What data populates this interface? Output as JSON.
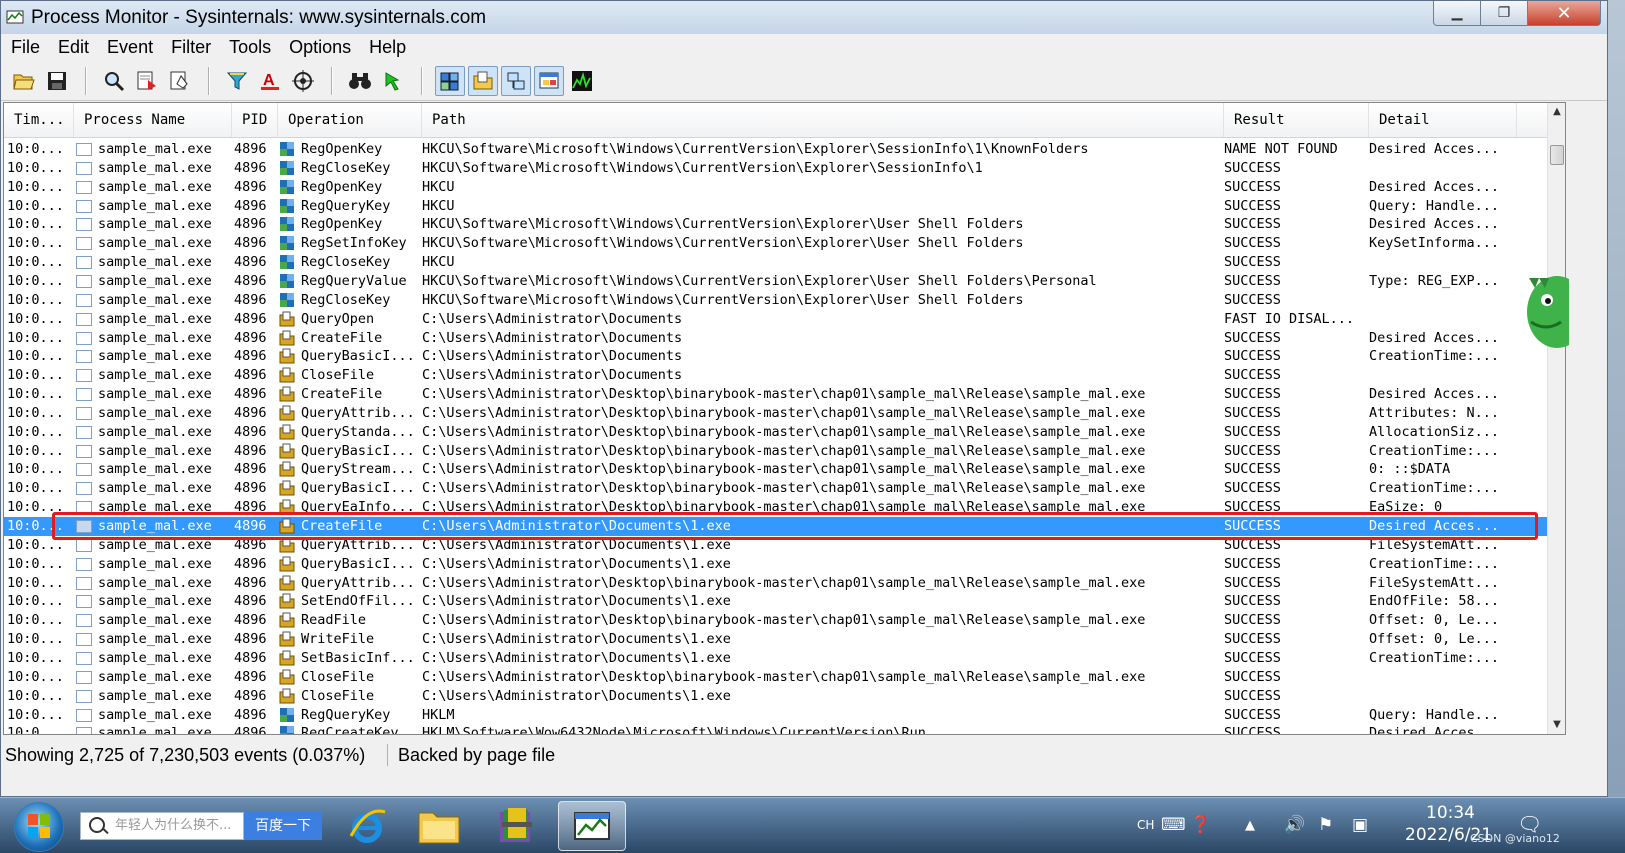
{
  "window": {
    "title": "Process Monitor - Sysinternals: www.sysinternals.com",
    "minimize": "▁",
    "maximize": "❐",
    "close": "✕"
  },
  "menu": [
    "File",
    "Edit",
    "Event",
    "Filter",
    "Tools",
    "Options",
    "Help"
  ],
  "toolbar": {
    "open": "📂",
    "save": "💾",
    "find": "🔍",
    "jump": "⇗",
    "bookmark": "✎",
    "filter": "⏷",
    "highlight": "A",
    "target": "⊕",
    "binoculars": "👓",
    "jump_to": "➜",
    "show_registry": "▦",
    "show_file": "▤",
    "show_network": "⧉",
    "show_process": "▣",
    "show_profiling": "▲"
  },
  "columns": [
    "Tim...",
    "Process Name",
    "PID",
    "Operation",
    "Path",
    "Result",
    "Detail"
  ],
  "rows": [
    {
      "time": "10:0...",
      "pname": "sample_mal.exe",
      "pid": "4896",
      "op": "RegOpenKey",
      "path": "HKCU\\Software\\Microsoft\\Windows\\CurrentVersion\\Explorer\\SessionInfo\\1\\KnownFolders",
      "result": "NAME NOT FOUND",
      "detail": "Desired Acces...",
      "kind": "reg"
    },
    {
      "time": "10:0...",
      "pname": "sample_mal.exe",
      "pid": "4896",
      "op": "RegCloseKey",
      "path": "HKCU\\Software\\Microsoft\\Windows\\CurrentVersion\\Explorer\\SessionInfo\\1",
      "result": "SUCCESS",
      "detail": "",
      "kind": "reg"
    },
    {
      "time": "10:0...",
      "pname": "sample_mal.exe",
      "pid": "4896",
      "op": "RegOpenKey",
      "path": "HKCU",
      "result": "SUCCESS",
      "detail": "Desired Acces...",
      "kind": "reg"
    },
    {
      "time": "10:0...",
      "pname": "sample_mal.exe",
      "pid": "4896",
      "op": "RegQueryKey",
      "path": "HKCU",
      "result": "SUCCESS",
      "detail": "Query: Handle...",
      "kind": "reg"
    },
    {
      "time": "10:0...",
      "pname": "sample_mal.exe",
      "pid": "4896",
      "op": "RegOpenKey",
      "path": "HKCU\\Software\\Microsoft\\Windows\\CurrentVersion\\Explorer\\User Shell Folders",
      "result": "SUCCESS",
      "detail": "Desired Acces...",
      "kind": "reg"
    },
    {
      "time": "10:0...",
      "pname": "sample_mal.exe",
      "pid": "4896",
      "op": "RegSetInfoKey",
      "path": "HKCU\\Software\\Microsoft\\Windows\\CurrentVersion\\Explorer\\User Shell Folders",
      "result": "SUCCESS",
      "detail": "KeySetInforma...",
      "kind": "reg"
    },
    {
      "time": "10:0...",
      "pname": "sample_mal.exe",
      "pid": "4896",
      "op": "RegCloseKey",
      "path": "HKCU",
      "result": "SUCCESS",
      "detail": "",
      "kind": "reg"
    },
    {
      "time": "10:0...",
      "pname": "sample_mal.exe",
      "pid": "4896",
      "op": "RegQueryValue",
      "path": "HKCU\\Software\\Microsoft\\Windows\\CurrentVersion\\Explorer\\User Shell Folders\\Personal",
      "result": "SUCCESS",
      "detail": "Type: REG_EXP...",
      "kind": "reg"
    },
    {
      "time": "10:0...",
      "pname": "sample_mal.exe",
      "pid": "4896",
      "op": "RegCloseKey",
      "path": "HKCU\\Software\\Microsoft\\Windows\\CurrentVersion\\Explorer\\User Shell Folders",
      "result": "SUCCESS",
      "detail": "",
      "kind": "reg"
    },
    {
      "time": "10:0...",
      "pname": "sample_mal.exe",
      "pid": "4896",
      "op": "QueryOpen",
      "path": "C:\\Users\\Administrator\\Documents",
      "result": "FAST IO DISAL...",
      "detail": "",
      "kind": "file"
    },
    {
      "time": "10:0...",
      "pname": "sample_mal.exe",
      "pid": "4896",
      "op": "CreateFile",
      "path": "C:\\Users\\Administrator\\Documents",
      "result": "SUCCESS",
      "detail": "Desired Acces...",
      "kind": "file"
    },
    {
      "time": "10:0...",
      "pname": "sample_mal.exe",
      "pid": "4896",
      "op": "QueryBasicI...",
      "path": "C:\\Users\\Administrator\\Documents",
      "result": "SUCCESS",
      "detail": "CreationTime:...",
      "kind": "file"
    },
    {
      "time": "10:0...",
      "pname": "sample_mal.exe",
      "pid": "4896",
      "op": "CloseFile",
      "path": "C:\\Users\\Administrator\\Documents",
      "result": "SUCCESS",
      "detail": "",
      "kind": "file"
    },
    {
      "time": "10:0...",
      "pname": "sample_mal.exe",
      "pid": "4896",
      "op": "CreateFile",
      "path": "C:\\Users\\Administrator\\Desktop\\binarybook-master\\chap01\\sample_mal\\Release\\sample_mal.exe",
      "result": "SUCCESS",
      "detail": "Desired Acces...",
      "kind": "file"
    },
    {
      "time": "10:0...",
      "pname": "sample_mal.exe",
      "pid": "4896",
      "op": "QueryAttrib...",
      "path": "C:\\Users\\Administrator\\Desktop\\binarybook-master\\chap01\\sample_mal\\Release\\sample_mal.exe",
      "result": "SUCCESS",
      "detail": "Attributes: N...",
      "kind": "file"
    },
    {
      "time": "10:0...",
      "pname": "sample_mal.exe",
      "pid": "4896",
      "op": "QueryStanda...",
      "path": "C:\\Users\\Administrator\\Desktop\\binarybook-master\\chap01\\sample_mal\\Release\\sample_mal.exe",
      "result": "SUCCESS",
      "detail": "AllocationSiz...",
      "kind": "file"
    },
    {
      "time": "10:0...",
      "pname": "sample_mal.exe",
      "pid": "4896",
      "op": "QueryBasicI...",
      "path": "C:\\Users\\Administrator\\Desktop\\binarybook-master\\chap01\\sample_mal\\Release\\sample_mal.exe",
      "result": "SUCCESS",
      "detail": "CreationTime:...",
      "kind": "file"
    },
    {
      "time": "10:0...",
      "pname": "sample_mal.exe",
      "pid": "4896",
      "op": "QueryStream...",
      "path": "C:\\Users\\Administrator\\Desktop\\binarybook-master\\chap01\\sample_mal\\Release\\sample_mal.exe",
      "result": "SUCCESS",
      "detail": "0: ::$DATA",
      "kind": "file"
    },
    {
      "time": "10:0...",
      "pname": "sample_mal.exe",
      "pid": "4896",
      "op": "QueryBasicI...",
      "path": "C:\\Users\\Administrator\\Desktop\\binarybook-master\\chap01\\sample_mal\\Release\\sample_mal.exe",
      "result": "SUCCESS",
      "detail": "CreationTime:...",
      "kind": "file"
    },
    {
      "time": "10:0...",
      "pname": "sample_mal.exe",
      "pid": "4896",
      "op": "QueryEaInfo...",
      "path": "C:\\Users\\Administrator\\Desktop\\binarybook-master\\chap01\\sample_mal\\Release\\sample_mal.exe",
      "result": "SUCCESS",
      "detail": "EaSize: 0",
      "kind": "file"
    },
    {
      "time": "10:0...",
      "pname": "sample_mal.exe",
      "pid": "4896",
      "op": "CreateFile",
      "path": "C:\\Users\\Administrator\\Documents\\1.exe",
      "result": "SUCCESS",
      "detail": "Desired Acces...",
      "kind": "file",
      "selected": true
    },
    {
      "time": "10:0...",
      "pname": "sample_mal.exe",
      "pid": "4896",
      "op": "QueryAttrib...",
      "path": "C:\\Users\\Administrator\\Documents\\1.exe",
      "result": "SUCCESS",
      "detail": "FileSystemAtt...",
      "kind": "file"
    },
    {
      "time": "10:0...",
      "pname": "sample_mal.exe",
      "pid": "4896",
      "op": "QueryBasicI...",
      "path": "C:\\Users\\Administrator\\Documents\\1.exe",
      "result": "SUCCESS",
      "detail": "CreationTime:...",
      "kind": "file"
    },
    {
      "time": "10:0...",
      "pname": "sample_mal.exe",
      "pid": "4896",
      "op": "QueryAttrib...",
      "path": "C:\\Users\\Administrator\\Desktop\\binarybook-master\\chap01\\sample_mal\\Release\\sample_mal.exe",
      "result": "SUCCESS",
      "detail": "FileSystemAtt...",
      "kind": "file"
    },
    {
      "time": "10:0...",
      "pname": "sample_mal.exe",
      "pid": "4896",
      "op": "SetEndOfFil...",
      "path": "C:\\Users\\Administrator\\Documents\\1.exe",
      "result": "SUCCESS",
      "detail": "EndOfFile: 58...",
      "kind": "file"
    },
    {
      "time": "10:0...",
      "pname": "sample_mal.exe",
      "pid": "4896",
      "op": "ReadFile",
      "path": "C:\\Users\\Administrator\\Desktop\\binarybook-master\\chap01\\sample_mal\\Release\\sample_mal.exe",
      "result": "SUCCESS",
      "detail": "Offset: 0, Le...",
      "kind": "file"
    },
    {
      "time": "10:0...",
      "pname": "sample_mal.exe",
      "pid": "4896",
      "op": "WriteFile",
      "path": "C:\\Users\\Administrator\\Documents\\1.exe",
      "result": "SUCCESS",
      "detail": "Offset: 0, Le...",
      "kind": "file"
    },
    {
      "time": "10:0...",
      "pname": "sample_mal.exe",
      "pid": "4896",
      "op": "SetBasicInf...",
      "path": "C:\\Users\\Administrator\\Documents\\1.exe",
      "result": "SUCCESS",
      "detail": "CreationTime:...",
      "kind": "file"
    },
    {
      "time": "10:0...",
      "pname": "sample_mal.exe",
      "pid": "4896",
      "op": "CloseFile",
      "path": "C:\\Users\\Administrator\\Desktop\\binarybook-master\\chap01\\sample_mal\\Release\\sample_mal.exe",
      "result": "SUCCESS",
      "detail": "",
      "kind": "file"
    },
    {
      "time": "10:0...",
      "pname": "sample_mal.exe",
      "pid": "4896",
      "op": "CloseFile",
      "path": "C:\\Users\\Administrator\\Documents\\1.exe",
      "result": "SUCCESS",
      "detail": "",
      "kind": "file"
    },
    {
      "time": "10:0...",
      "pname": "sample_mal.exe",
      "pid": "4896",
      "op": "RegQueryKey",
      "path": "HKLM",
      "result": "SUCCESS",
      "detail": "Query: Handle...",
      "kind": "reg"
    },
    {
      "time": "10:0...",
      "pname": "sample_mal.exe",
      "pid": "4896",
      "op": "RegCreateKey",
      "path": "HKLM\\Software\\Wow6432Node\\Microsoft\\Windows\\CurrentVersion\\Run",
      "result": "SUCCESS",
      "detail": "Desired Acces...",
      "kind": "reg"
    }
  ],
  "status": {
    "events": "Showing 2,725 of 7,230,503 events (0.037%)",
    "backing": "Backed by page file"
  },
  "taskbar": {
    "search_placeholder": "年轻人为什么换不...",
    "search_button": "百度一下",
    "lang": "CH",
    "time": "10:34",
    "date": "2022/6/21",
    "watermark": "CSDN @viano12"
  },
  "colors": {
    "selection": "#3399ff",
    "highlight_box": "#e21c1c",
    "reg_icon": "#1f6fb5",
    "file_icon": "#d9a520"
  }
}
